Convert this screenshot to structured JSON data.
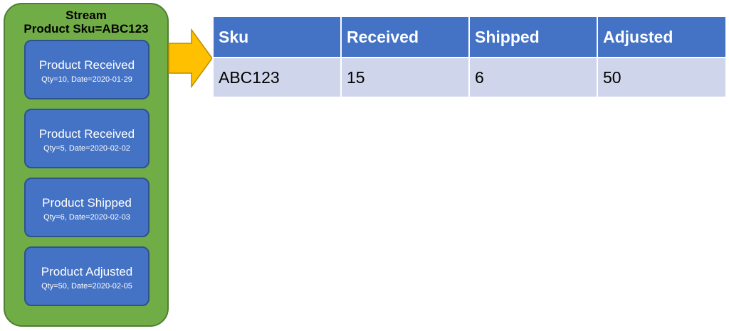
{
  "stream": {
    "title_line1": "Stream",
    "title_line2": "Product Sku=ABC123",
    "events": [
      {
        "title": "Product Received",
        "detail": "Qty=10, Date=2020-01-29"
      },
      {
        "title": "Product Received",
        "detail": "Qty=5, Date=2020-02-02"
      },
      {
        "title": "Product Shipped",
        "detail": "Qty=6, Date=2020-02-03"
      },
      {
        "title": "Product Adjusted",
        "detail": "Qty=50, Date=2020-02-05"
      }
    ]
  },
  "table": {
    "headers": [
      "Sku",
      "Received",
      "Shipped",
      "Adjusted"
    ],
    "row": [
      "ABC123",
      "15",
      "6",
      "50"
    ]
  },
  "colors": {
    "stream_fill": "#70ad47",
    "event_fill": "#4472c4",
    "arrow_fill": "#ffc000",
    "table_header": "#4472c4",
    "table_row": "#cfd5ea"
  }
}
